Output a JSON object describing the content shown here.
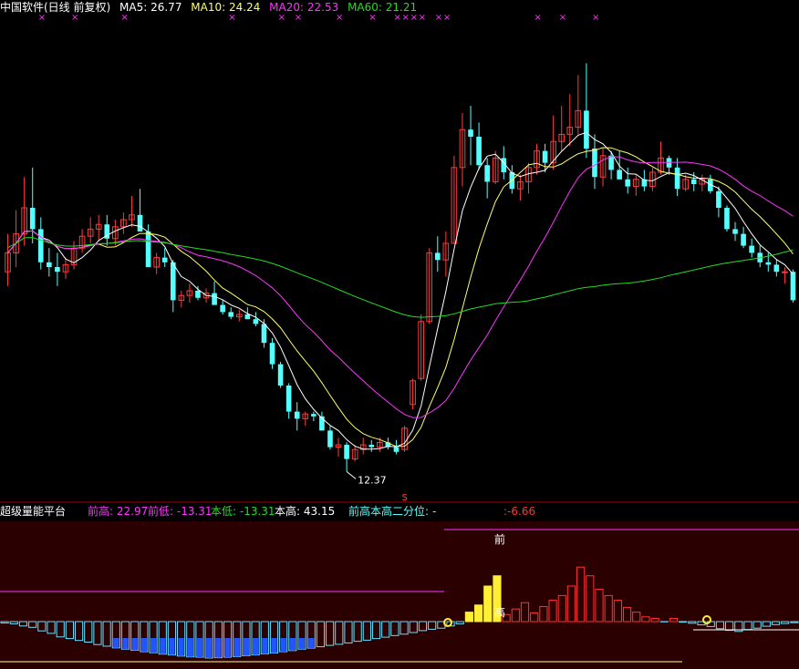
{
  "header": {
    "title": "中国软件(日线 前复权)",
    "ma5": {
      "label": "MA5:",
      "value": "26.77"
    },
    "ma10": {
      "label": "MA10:",
      "value": "24.24"
    },
    "ma20": {
      "label": "MA20:",
      "value": "22.53"
    },
    "ma60": {
      "label": "MA60:",
      "value": "21.21"
    }
  },
  "sub_header": {
    "title": "超级量能平台",
    "prev_high": {
      "label": "前高:",
      "value": "22.97"
    },
    "prev_low": {
      "label": "前低:",
      "value": "-13.31"
    },
    "this_low": {
      "label": "本低:",
      "value": "-13.31"
    },
    "this_high": {
      "label": "本高:",
      "value": "43.15"
    },
    "quantile": {
      "label": "前高本高二分位:",
      "value": "-6.66"
    }
  },
  "markers": {
    "x_mark": "×",
    "low_label": "12.37",
    "s_mark": "S",
    "qian": "前",
    "gao": "高"
  },
  "colors": {
    "up": "#ff3c3c",
    "down": "#54ffff",
    "ma5": "#ffffff",
    "ma10": "#ffff66",
    "ma20": "#ff33ff",
    "ma60": "#22dd22",
    "pos_bar": "#ff3333",
    "pos_bar_strong": "#ffee33",
    "neg_bar": "#66e0ff",
    "neg_bar_strong": "#2255ff"
  },
  "chart_data": {
    "type": "candlestick",
    "main_range": [
      11.5,
      31.5
    ],
    "candles": [
      [
        20.8,
        22.4,
        20.2,
        21.6
      ],
      [
        21.6,
        23.4,
        21.0,
        22.4
      ],
      [
        22.4,
        24.8,
        21.9,
        23.5
      ],
      [
        23.5,
        25.2,
        22.0,
        22.6
      ],
      [
        22.6,
        23.1,
        20.9,
        21.2
      ],
      [
        21.2,
        21.8,
        20.6,
        21.0
      ],
      [
        21.0,
        21.6,
        20.2,
        20.8
      ],
      [
        20.8,
        21.4,
        20.5,
        21.1
      ],
      [
        21.1,
        22.1,
        20.9,
        21.8
      ],
      [
        21.8,
        22.6,
        21.6,
        22.3
      ],
      [
        22.3,
        23.1,
        22.0,
        22.6
      ],
      [
        22.6,
        23.2,
        22.1,
        22.8
      ],
      [
        22.8,
        23.2,
        21.9,
        22.2
      ],
      [
        22.2,
        23.0,
        21.9,
        22.7
      ],
      [
        22.7,
        23.3,
        22.4,
        23.0
      ],
      [
        23.0,
        24.0,
        22.7,
        23.2
      ],
      [
        23.2,
        24.3,
        22.9,
        22.5
      ],
      [
        22.5,
        22.8,
        21.0,
        21.0
      ],
      [
        21.0,
        21.6,
        20.7,
        21.4
      ],
      [
        21.4,
        21.8,
        21.0,
        21.2
      ],
      [
        21.2,
        21.3,
        19.1,
        19.6
      ],
      [
        19.6,
        20.0,
        19.3,
        19.8
      ],
      [
        19.8,
        20.3,
        19.5,
        20.0
      ],
      [
        20.0,
        20.2,
        19.6,
        19.7
      ],
      [
        19.7,
        20.1,
        19.5,
        19.9
      ],
      [
        19.9,
        20.4,
        19.6,
        19.4
      ],
      [
        19.4,
        19.6,
        19.0,
        19.1
      ],
      [
        19.1,
        19.3,
        18.8,
        18.9
      ],
      [
        18.9,
        19.2,
        18.7,
        19.0
      ],
      [
        19.0,
        19.3,
        18.8,
        18.8
      ],
      [
        18.8,
        19.1,
        18.5,
        18.6
      ],
      [
        18.6,
        18.8,
        17.6,
        17.8
      ],
      [
        17.8,
        18.0,
        16.7,
        16.9
      ],
      [
        16.9,
        17.0,
        15.9,
        16.0
      ],
      [
        16.0,
        16.1,
        14.6,
        14.9
      ],
      [
        14.9,
        15.3,
        14.1,
        14.6
      ],
      [
        14.6,
        14.9,
        14.3,
        14.8
      ],
      [
        14.8,
        14.9,
        14.5,
        14.7
      ],
      [
        14.7,
        14.9,
        14.2,
        14.1
      ],
      [
        14.1,
        14.3,
        13.3,
        13.4
      ],
      [
        13.4,
        13.8,
        13.0,
        13.5
      ],
      [
        13.5,
        13.6,
        12.37,
        12.9
      ],
      [
        12.9,
        13.5,
        12.8,
        13.3
      ],
      [
        13.3,
        13.8,
        13.1,
        13.5
      ],
      [
        13.5,
        13.7,
        13.2,
        13.4
      ],
      [
        13.4,
        13.8,
        13.2,
        13.6
      ],
      [
        13.6,
        13.8,
        13.3,
        13.4
      ],
      [
        13.4,
        13.7,
        13.1,
        13.2
      ],
      [
        13.3,
        14.3,
        13.2,
        14.2
      ],
      [
        15.2,
        16.3,
        15.0,
        16.2
      ],
      [
        16.3,
        19.0,
        16.2,
        18.7
      ],
      [
        18.7,
        21.8,
        18.6,
        21.6
      ],
      [
        21.6,
        22.3,
        20.8,
        21.3
      ],
      [
        21.3,
        22.5,
        20.6,
        22.0
      ],
      [
        22.0,
        25.7,
        22.0,
        25.2
      ],
      [
        25.2,
        27.5,
        24.4,
        26.8
      ],
      [
        26.8,
        27.8,
        25.3,
        26.5
      ],
      [
        26.5,
        27.1,
        25.1,
        25.3
      ],
      [
        25.3,
        25.6,
        23.9,
        24.6
      ],
      [
        24.6,
        25.9,
        24.5,
        25.6
      ],
      [
        25.6,
        26.1,
        24.7,
        25.0
      ],
      [
        25.0,
        25.3,
        24.1,
        24.3
      ],
      [
        24.3,
        24.9,
        23.8,
        24.6
      ],
      [
        24.6,
        25.4,
        24.1,
        25.2
      ],
      [
        25.2,
        26.2,
        24.9,
        25.9
      ],
      [
        25.9,
        26.2,
        25.0,
        25.4
      ],
      [
        25.4,
        27.4,
        25.1,
        26.3
      ],
      [
        26.3,
        27.8,
        25.9,
        26.6
      ],
      [
        26.6,
        28.3,
        26.1,
        26.9
      ],
      [
        26.9,
        29.1,
        26.6,
        27.6
      ],
      [
        27.6,
        29.6,
        25.6,
        26.0
      ],
      [
        26.0,
        26.6,
        24.3,
        24.8
      ],
      [
        24.8,
        26.0,
        24.4,
        25.7
      ],
      [
        25.7,
        25.9,
        24.7,
        25.1
      ],
      [
        25.1,
        25.9,
        24.7,
        24.7
      ],
      [
        24.7,
        25.2,
        24.1,
        24.4
      ],
      [
        24.4,
        24.9,
        24.0,
        24.7
      ],
      [
        24.7,
        25.1,
        24.2,
        24.4
      ],
      [
        24.4,
        25.2,
        24.2,
        25.0
      ],
      [
        25.0,
        26.3,
        24.9,
        25.6
      ],
      [
        25.6,
        25.7,
        24.9,
        25.2
      ],
      [
        25.2,
        25.6,
        24.0,
        24.3
      ],
      [
        24.3,
        24.9,
        24.2,
        24.7
      ],
      [
        24.7,
        25.0,
        24.2,
        24.5
      ],
      [
        24.5,
        24.9,
        24.2,
        24.7
      ],
      [
        24.7,
        24.9,
        24.1,
        24.2
      ],
      [
        24.2,
        24.4,
        23.1,
        23.5
      ],
      [
        23.5,
        23.6,
        22.5,
        22.6
      ],
      [
        22.6,
        22.9,
        22.1,
        22.4
      ],
      [
        22.4,
        22.7,
        21.8,
        21.9
      ],
      [
        21.9,
        22.2,
        21.4,
        21.6
      ],
      [
        21.6,
        21.9,
        21.0,
        21.2
      ],
      [
        21.2,
        21.6,
        20.8,
        21.1
      ],
      [
        21.1,
        21.3,
        20.6,
        20.8
      ],
      [
        20.8,
        21.0,
        20.3,
        20.8
      ],
      [
        20.8,
        20.9,
        19.5,
        19.6
      ]
    ],
    "ma_series_note": "MA lines computed from candle closes",
    "indicator": {
      "values": [
        -0.5,
        -0.8,
        -1.6,
        -2.1,
        -3.4,
        -4.3,
        -5.6,
        -6.2,
        -6.9,
        -7.5,
        -8.4,
        -9.0,
        -9.6,
        -10.1,
        -10.5,
        -11.0,
        -11.4,
        -11.9,
        -12.2,
        -12.6,
        -12.9,
        -13.0,
        -13.31,
        -13.2,
        -13.0,
        -12.8,
        -12.5,
        -12.2,
        -11.8,
        -11.5,
        -11.0,
        -10.6,
        -10.1,
        -9.7,
        -9.2,
        -8.7,
        -8.3,
        -7.8,
        -7.2,
        -6.8,
        -6.2,
        -5.7,
        -5.1,
        -4.6,
        -4.0,
        -3.3,
        -2.8,
        -2.4,
        -1.6,
        -0.8,
        1.2,
        2.1,
        4.5,
        5.8,
        0.9,
        1.6,
        2.4,
        1.1,
        1.9,
        2.7,
        3.3,
        4.5,
        6.9,
        5.8,
        4.1,
        3.3,
        2.7,
        1.8,
        1.2,
        0.6,
        0.4,
        -0.1,
        0.4,
        -0.2,
        -0.6,
        -1.2,
        -1.8,
        -2.6,
        -3.2,
        -3.6,
        -2.9,
        -2.4,
        -1.7,
        -1.1,
        -0.7,
        -0.4
      ],
      "prev_high": 22.97,
      "prev_low": -13.31,
      "this_low": -13.31,
      "this_high": 43.15,
      "quantile": -6.66
    }
  }
}
